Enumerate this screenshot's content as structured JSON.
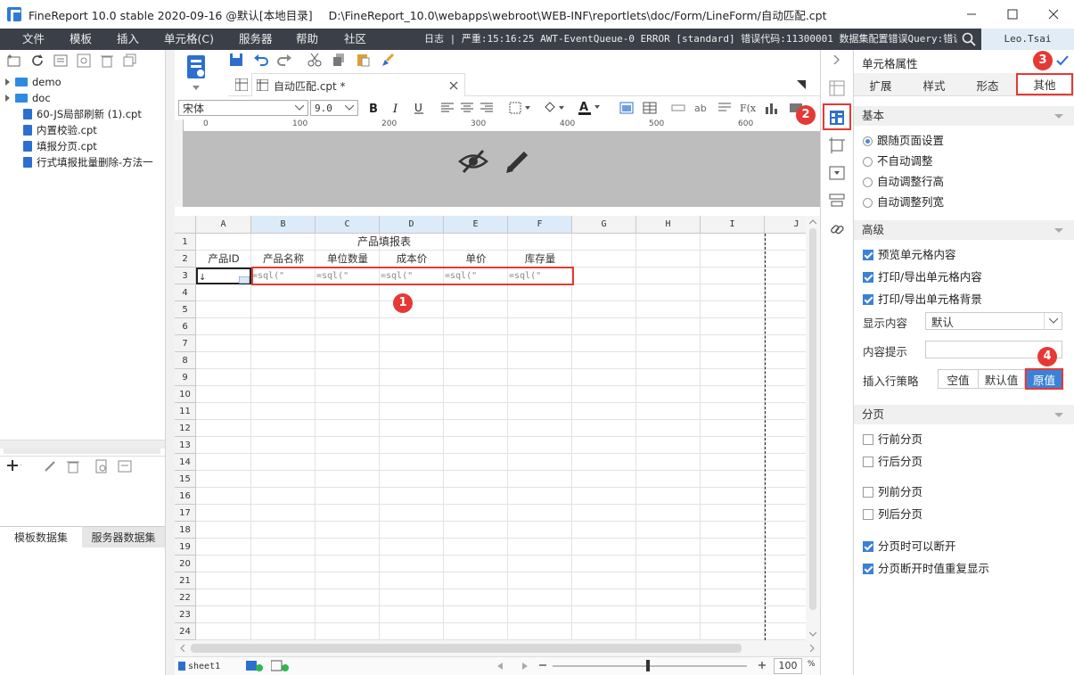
{
  "window": {
    "title": "FineReport 10.0 stable 2020-09-16 @默认[本地目录]",
    "path": "D:\\FineReport_10.0\\webapps\\webroot\\WEB-INF\\reportlets\\doc/Form/LineForm/自动匹配.cpt"
  },
  "menu": {
    "items": [
      "文件",
      "模板",
      "插入",
      "单元格(C)",
      "服务器",
      "帮助",
      "社区"
    ],
    "log": "日志 | 严重:15:16:25 AWT-EventQueue-0 ERROR [standard] 错误代码:11300001 数据集配置错误Query:错误...",
    "user": "Leo.Tsai"
  },
  "tree": {
    "items": [
      {
        "type": "folder",
        "label": "demo"
      },
      {
        "type": "folder",
        "label": "doc"
      },
      {
        "type": "file",
        "label": "60-JS局部刷新 (1).cpt"
      },
      {
        "type": "file",
        "label": "内置校验.cpt"
      },
      {
        "type": "file",
        "label": "填报分页.cpt"
      },
      {
        "type": "file",
        "label": "行式填报批量删除-方法一"
      }
    ]
  },
  "dataset_tabs": [
    "模板数据集",
    "服务器数据集"
  ],
  "editor": {
    "tab_label": "自动匹配.cpt *",
    "font_name": "宋体",
    "font_size": "9.0",
    "ruler_ticks": [
      "0",
      "100",
      "200",
      "300",
      "400",
      "500",
      "600"
    ]
  },
  "sheet": {
    "columns": [
      "A",
      "B",
      "C",
      "D",
      "E",
      "F",
      "G",
      "H",
      "I",
      "J"
    ],
    "rows": [
      "1",
      "2",
      "3",
      "4",
      "5",
      "6",
      "7",
      "8",
      "9",
      "10",
      "11",
      "12",
      "13",
      "14",
      "15",
      "16",
      "17",
      "18",
      "19",
      "20",
      "21",
      "22",
      "23",
      "24"
    ],
    "title": "产品填报表",
    "headers": [
      "产品ID",
      "产品名称",
      "单位数量",
      "成本价",
      "单价",
      "库存量"
    ],
    "row3": [
      "=sql(\"",
      "=sql(\"",
      "=sql(\"",
      "=sql(\"",
      "=sql(\""
    ],
    "row3_a": "↓",
    "sheet_tab": "sheet1",
    "zoom": "100",
    "zoom_unit": "%"
  },
  "props": {
    "title": "单元格属性",
    "tabs": [
      "扩展",
      "样式",
      "形态",
      "其他"
    ],
    "active_tab": "其他",
    "basic": {
      "label": "基本",
      "options": [
        "跟随页面设置",
        "不自动调整",
        "自动调整行高",
        "自动调整列宽"
      ]
    },
    "advanced": {
      "label": "高级",
      "checks": [
        "预览单元格内容",
        "打印/导出单元格内容",
        "打印/导出单元格背景"
      ],
      "display_label": "显示内容",
      "display_value": "默认",
      "tooltip_label": "内容提示",
      "insert_label": "插入行策略",
      "insert_options": [
        "空值",
        "默认值",
        "原值"
      ]
    },
    "paging": {
      "label": "分页",
      "checks": [
        "行前分页",
        "行后分页",
        "列前分页",
        "列后分页",
        "分页时可以断开",
        "分页断开时值重复显示"
      ]
    }
  },
  "annotations": [
    "1",
    "2",
    "3",
    "4"
  ],
  "colors": {
    "menubar": "#3b3f48",
    "accent": "#3b82d6",
    "annotation": "#e53935"
  }
}
